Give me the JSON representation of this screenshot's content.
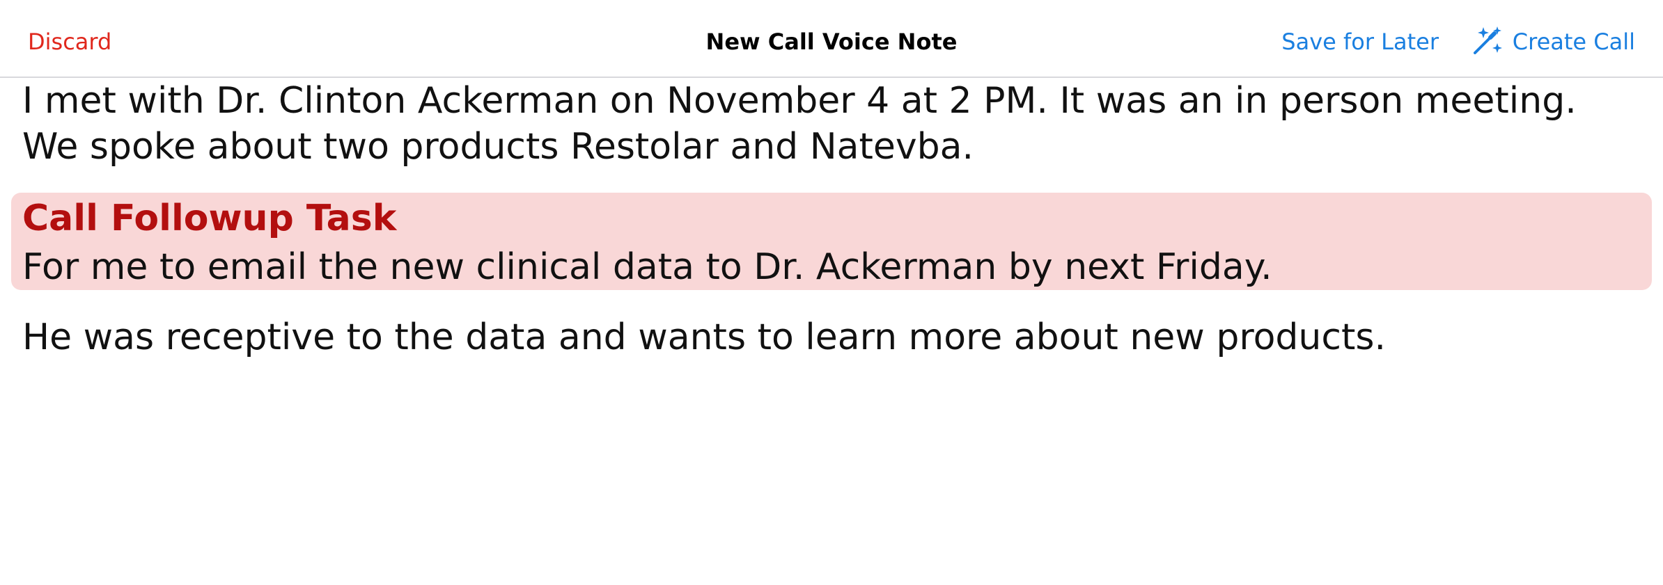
{
  "navbar": {
    "discard_label": "Discard",
    "title": "New Call Voice Note",
    "save_label": "Save for Later",
    "create_label": "Create Call",
    "create_icon": "magic-wand-icon"
  },
  "note": {
    "paragraph_1": "I met with Dr. Clinton Ackerman on November 4 at 2 PM. It was an in person meeting. We spoke about two products Restolar and Natevba.",
    "task": {
      "title": "Call Followup Task",
      "body": "For me to email the new clinical data to Dr. Ackerman by next Friday."
    },
    "paragraph_2": "He was receptive to the data and wants to learn more about new products."
  },
  "colors": {
    "destructive": "#e0271c",
    "accent": "#1a7fe0",
    "task_background": "#f9d7d7",
    "task_title": "#b30f0f"
  }
}
